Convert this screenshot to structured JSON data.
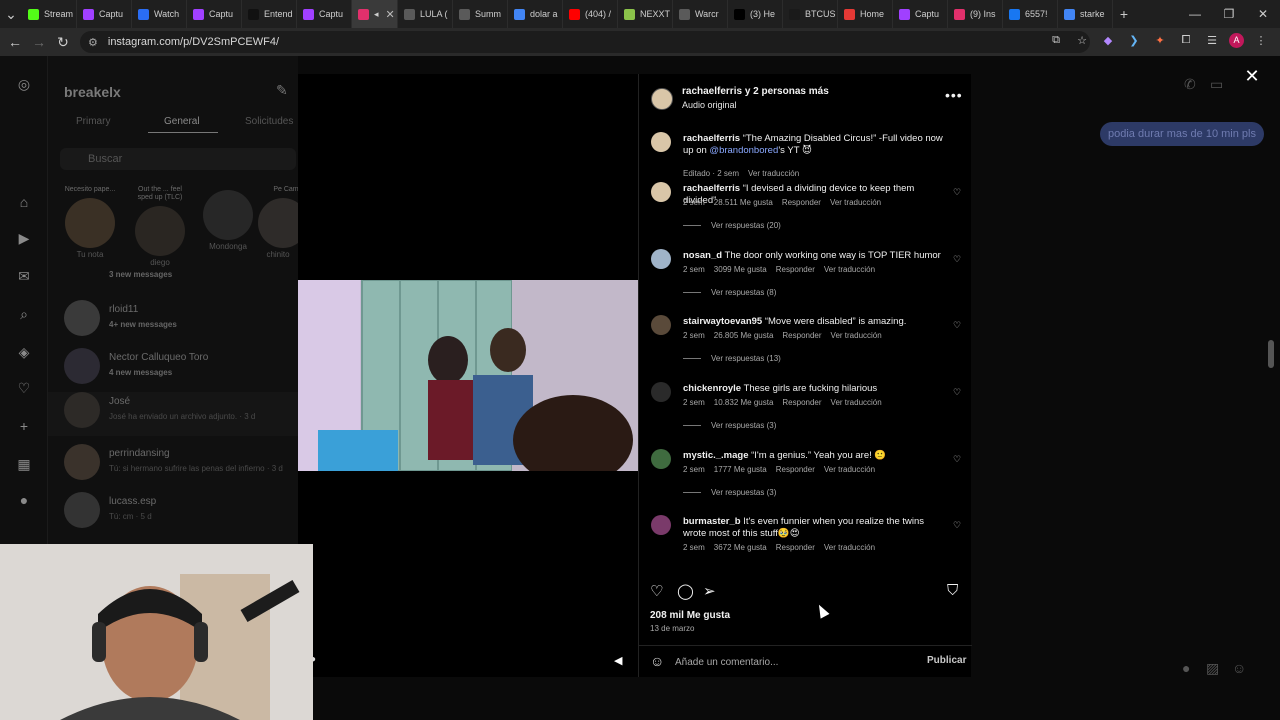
{
  "browser": {
    "tabs": [
      {
        "label": "Stream",
        "icon": "kick-icon",
        "color": "#53fc18"
      },
      {
        "label": "Captu",
        "icon": "capture-icon",
        "color": "#a040ff"
      },
      {
        "label": "Watch",
        "icon": "watch-icon",
        "color": "#2a6df4"
      },
      {
        "label": "Captu",
        "icon": "capture-icon",
        "color": "#a040ff"
      },
      {
        "label": "Entend",
        "icon": "tiktok-icon",
        "color": "#111111"
      },
      {
        "label": "Captu",
        "icon": "capture-icon",
        "color": "#a040ff"
      },
      {
        "label": "",
        "icon": "instagram-icon",
        "color": "#e1306c",
        "active": true
      },
      {
        "label": "LULA (",
        "icon": "globe-icon",
        "color": "#5a5a5a"
      },
      {
        "label": "Summ",
        "icon": "summ-icon",
        "color": "#5a5a5a"
      },
      {
        "label": "dolar a",
        "icon": "google-icon",
        "color": "#4285f4"
      },
      {
        "label": "(404) /",
        "icon": "youtube-icon",
        "color": "#ff0000"
      },
      {
        "label": "NEXXT",
        "icon": "nexxt-icon",
        "color": "#8bc34a"
      },
      {
        "label": "Warcr",
        "icon": "warcr-icon",
        "color": "#5a5a5a"
      },
      {
        "label": "(3) He",
        "icon": "x-icon",
        "color": "#000000"
      },
      {
        "label": "BTCUS",
        "icon": "tradingview-icon",
        "color": "#1a1a1a"
      },
      {
        "label": "Home",
        "icon": "home-icon",
        "color": "#e53935"
      },
      {
        "label": "Captu",
        "icon": "capture-icon",
        "color": "#a040ff"
      },
      {
        "label": "(9) Ins",
        "icon": "instagram-icon",
        "color": "#e1306c"
      },
      {
        "label": "6557!",
        "icon": "facebook-icon",
        "color": "#1877f2"
      },
      {
        "label": "starke",
        "icon": "google-icon",
        "color": "#4285f4"
      }
    ],
    "url": "instagram.com/p/DV2SmPCEWF4/",
    "profile_initial": "A"
  },
  "dm": {
    "username": "breakelx",
    "tabs": [
      "Primary",
      "General",
      "Solicitudes"
    ],
    "search_placeholder": "Buscar",
    "notes": [
      {
        "bubble": "Necesito pape...",
        "name": "Tu nota"
      },
      {
        "bubble": "Out the ... feel sped up (TLC)",
        "name": "diego"
      },
      {
        "bubble": "",
        "name": "Mondonga"
      },
      {
        "bubble": "Pe Cam",
        "name": "chinito"
      }
    ],
    "conversations": [
      {
        "name": "",
        "sub": "3 new messages"
      },
      {
        "name": "rloid11",
        "sub": "4+ new messages"
      },
      {
        "name": "Nector Calluqueo Toro",
        "sub": "4 new messages"
      },
      {
        "name": "José",
        "sub": "José ha enviado un archivo adjunto. · 3 d"
      },
      {
        "name": "perrindansing",
        "sub": "Tú: si hermano sufrire las penas del infierno · 3 d"
      },
      {
        "name": "lucass.esp",
        "sub": "Tú: cm · 5 d"
      }
    ]
  },
  "chat": {
    "bubble": "podia durar mas de 10 min pls"
  },
  "post": {
    "header_user": "rachaelferris y 2 personas más",
    "header_audio": "Audio original",
    "caption": {
      "user": "rachaelferris",
      "text_before": "“The Amazing Disabled Circus!” -Full video now up on ",
      "mention": "@brandonbored",
      "text_after": "’s YT 😈",
      "meta": [
        "Editado · 2 sem",
        "Ver traducción"
      ]
    },
    "comments": [
      {
        "user": "rachaelferris",
        "text": "“I devised a dividing device to keep them divided”",
        "time": "2 sem",
        "likes": "28.511 Me gusta",
        "reply": "Responder",
        "translate": "Ver traducción",
        "replies": "Ver respuestas (20)"
      },
      {
        "user": "nosan_d",
        "text": "The door only working one way is TOP TIER humor",
        "time": "2 sem",
        "likes": "3099 Me gusta",
        "reply": "Responder",
        "translate": "Ver traducción",
        "replies": "Ver respuestas (8)"
      },
      {
        "user": "stairwaytoevan95",
        "text": "“Move were disabled” is amazing.",
        "time": "2 sem",
        "likes": "26.805 Me gusta",
        "reply": "Responder",
        "translate": "Ver traducción",
        "replies": "Ver respuestas (13)"
      },
      {
        "user": "chickenroyle",
        "text": "These girls are fucking hilarious",
        "time": "2 sem",
        "likes": "10.832 Me gusta",
        "reply": "Responder",
        "translate": "Ver traducción",
        "replies": "Ver respuestas (3)"
      },
      {
        "user": "mystic._.mage",
        "text": "“I'm a genius.” Yeah you are! 🙂",
        "time": "2 sem",
        "likes": "1777 Me gusta",
        "reply": "Responder",
        "translate": "Ver traducción",
        "replies": "Ver respuestas (3)"
      },
      {
        "user": "burmaster_b",
        "text": "It's even funnier when you realize the twins wrote most of this stuff🥹😍",
        "time": "2 sem",
        "likes": "3672 Me gusta",
        "reply": "Responder",
        "translate": "Ver traducción",
        "replies": ""
      }
    ],
    "likes": "208 mil Me gusta",
    "date": "13 de marzo",
    "comment_placeholder": "Añade un comentario...",
    "publish_label": "Publicar"
  }
}
